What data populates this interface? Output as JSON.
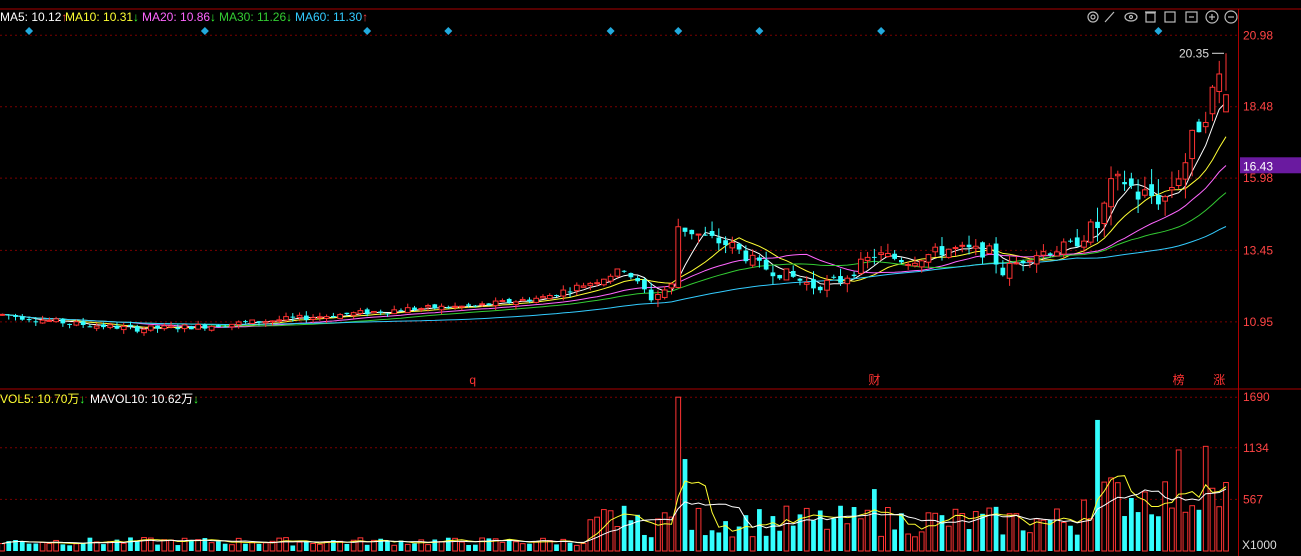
{
  "top_legend": [
    {
      "label": "MA5: 10.12",
      "arrow": "↑",
      "color": "#ffffff"
    },
    {
      "label": "MA10: 10.31",
      "arrow": "↓",
      "color": "#ffff33"
    },
    {
      "label": "MA20: 10.86",
      "arrow": "↓",
      "color": "#ff66ff"
    },
    {
      "label": "MA30: 11.26",
      "arrow": "↓",
      "color": "#33cc33"
    },
    {
      "label": "MA60: 11.30",
      "arrow": "↑",
      "color": "#33ccff"
    }
  ],
  "vol_legend": [
    {
      "label": "VOL5: 10.70万",
      "arrow": "↓",
      "color": "#ffff33"
    },
    {
      "label": "MAVOL10: 10.62万",
      "arrow": "↓",
      "color": "#ffffff"
    }
  ],
  "colors": {
    "up": "#ff3333",
    "down": "#33ffff",
    "grid": "#7a0000",
    "axis_text": "#ff4444",
    "vol_axis_text": "#ff4444",
    "current_price_bg": "#6a1aa0"
  },
  "toolbar_icons": [
    "settings-icon",
    "pen-icon",
    "eye-icon",
    "trash-icon",
    "layers-icon",
    "text-icon",
    "zoom-in-icon",
    "zoom-out-icon"
  ],
  "chart_data": [
    {
      "type": "candlestick",
      "yaxis_ticks": [
        "20.98",
        "18.48",
        "15.98",
        "13.45",
        "10.95"
      ],
      "ylim": [
        8.6,
        21.9
      ],
      "current_price_label": "16.43",
      "current_price": 16.43,
      "high_marker_label": "20.35",
      "high_marker_value": 20.35,
      "event_labels": [
        {
          "text": "q",
          "index": 70
        },
        {
          "text": "财",
          "index": 129
        },
        {
          "text": "榜",
          "index": 174
        },
        {
          "text": "涨",
          "index": 180
        }
      ],
      "event_diamond_indices": [
        4,
        30,
        54,
        66,
        90,
        100,
        112,
        130,
        171
      ],
      "ma_values": {
        "MA5": 10.12,
        "MA10": 10.31,
        "MA20": 10.86,
        "MA30": 11.26,
        "MA60": 11.3
      },
      "trend_keypoints": [
        [
          0,
          11.2
        ],
        [
          10,
          10.9
        ],
        [
          20,
          10.7
        ],
        [
          30,
          10.8
        ],
        [
          40,
          11.0
        ],
        [
          50,
          11.2
        ],
        [
          60,
          11.4
        ],
        [
          70,
          11.5
        ],
        [
          80,
          11.8
        ],
        [
          88,
          12.4
        ],
        [
          92,
          12.8
        ],
        [
          96,
          11.8
        ],
        [
          99,
          12.2
        ],
        [
          100,
          14.3
        ],
        [
          104,
          13.9
        ],
        [
          108,
          13.6
        ],
        [
          112,
          12.9
        ],
        [
          116,
          12.6
        ],
        [
          120,
          12.2
        ],
        [
          124,
          12.4
        ],
        [
          129,
          13.3
        ],
        [
          134,
          13.1
        ],
        [
          140,
          13.5
        ],
        [
          146,
          13.4
        ],
        [
          148,
          12.7
        ],
        [
          152,
          13.3
        ],
        [
          158,
          13.6
        ],
        [
          162,
          14.3
        ],
        [
          164,
          15.6
        ],
        [
          166,
          15.9
        ],
        [
          168,
          15.4
        ],
        [
          172,
          15.3
        ],
        [
          175,
          16.6
        ],
        [
          177,
          17.9
        ],
        [
          179,
          18.9
        ],
        [
          181,
          20.1
        ]
      ],
      "series_count": 182
    },
    {
      "type": "bar",
      "yaxis_ticks": [
        "1690",
        "1134",
        "567"
      ],
      "ylim": [
        0,
        1780
      ],
      "unit_label": "X1000",
      "spike_values": [
        [
          100,
          1690
        ],
        [
          101,
          1010
        ],
        [
          129,
          680
        ],
        [
          162,
          1440
        ],
        [
          174,
          1110
        ],
        [
          178,
          1150
        ]
      ]
    }
  ]
}
